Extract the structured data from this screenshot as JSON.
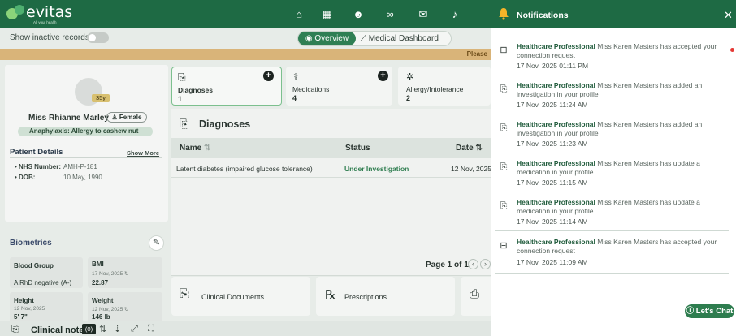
{
  "app": {
    "brand": "evitas",
    "tagline": "All your health"
  },
  "toolbar": {
    "show_inactive_label": "Show inactive records",
    "overview_tab": "Overview",
    "dashboard_tab": "Medical Dashboard"
  },
  "alert": {
    "text": "Please"
  },
  "patient": {
    "age": "35y",
    "name": "Miss Rhianne Marley",
    "gender": "Female",
    "allergy": "Anaphylaxis: Allergy to cashew nut",
    "details_title": "Patient Details",
    "show_more": "Show More",
    "nhs_label": "NHS Number:",
    "nhs_value": "AMH-P-181",
    "dob_label": "DOB:",
    "dob_value": "10 May, 1990"
  },
  "biometrics": {
    "title": "Biometrics",
    "blood_group_label": "Blood Group",
    "blood_group_value": "A RhD negative (A-)",
    "bmi_label": "BMI",
    "bmi_date": "17 Nov, 2025",
    "bmi_value": "22.87",
    "height_label": "Height",
    "height_date": "12 Nov, 2025",
    "height_value": "5' 7\"",
    "weight_label": "Weight",
    "weight_date": "12 Nov, 2025",
    "weight_value": "146 lb"
  },
  "tiles": [
    {
      "title": "Diagnoses",
      "count": "1"
    },
    {
      "title": "Medications",
      "count": "4"
    },
    {
      "title": "Allergy/Intolerance",
      "count": "2"
    }
  ],
  "diagnoses": {
    "title": "Diagnoses",
    "columns": [
      "Name",
      "Status",
      "Date"
    ],
    "rows": [
      {
        "name": "Latent diabetes (impaired glucose tolerance)",
        "status": "Under Investigation",
        "date": "12 Nov, 2025"
      }
    ],
    "pager": "Page 1 of 1"
  },
  "bottom_tiles": [
    "Clinical Documents",
    "Prescriptions"
  ],
  "clinical_note": {
    "label": "Clinical note",
    "count": "(0)"
  },
  "notifications": {
    "title": "Notifications",
    "items": [
      {
        "icon": "connection-icon",
        "source": "Healthcare Professional",
        "text": "Miss Karen Masters has accepted your connection request",
        "date": "17 Nov, 2025 01:11 PM",
        "unread": true
      },
      {
        "icon": "clipboard-icon",
        "source": "Healthcare Professional",
        "text": "Miss Karen Masters has added an investigation in your profile",
        "date": "17 Nov, 2025 11:24 AM",
        "unread": false
      },
      {
        "icon": "clipboard-icon",
        "source": "Healthcare Professional",
        "text": "Miss Karen Masters has added an investigation in your profile",
        "date": "17 Nov, 2025 11:23 AM",
        "unread": false
      },
      {
        "icon": "clipboard-icon",
        "source": "Healthcare Professional",
        "text": "Miss Karen Masters has update a medication in your profile",
        "date": "17 Nov, 2025 11:15 AM",
        "unread": false
      },
      {
        "icon": "clipboard-icon",
        "source": "Healthcare Professional",
        "text": "Miss Karen Masters has update a medication in your profile",
        "date": "17 Nov, 2025 11:14 AM",
        "unread": false
      },
      {
        "icon": "connection-icon",
        "source": "Healthcare Professional",
        "text": "Miss Karen Masters has accepted your connection request",
        "date": "17 Nov, 2025 11:09 AM",
        "unread": false
      }
    ]
  },
  "chat": {
    "label": "Let's Chat"
  },
  "colors": {
    "brand": "#1e6a44",
    "accent": "#2f7f54",
    "alert": "#d9b479",
    "unread": "#e53935"
  }
}
